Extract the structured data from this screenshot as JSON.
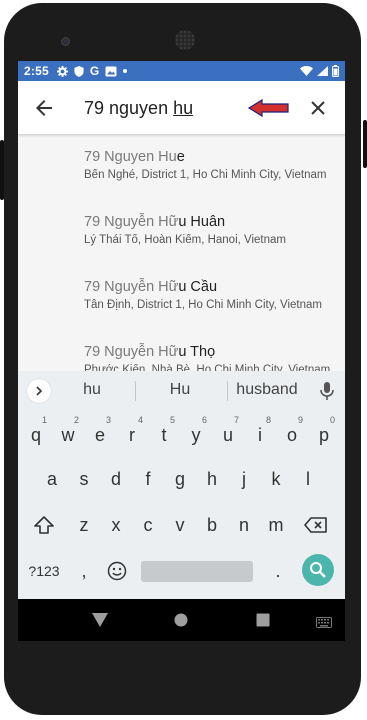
{
  "status_bar": {
    "time": "2:55",
    "icons_left": [
      "gear-icon",
      "shield-icon",
      "google-icon",
      "image-icon",
      "dot-icon"
    ],
    "icons_right": [
      "wifi-icon",
      "signal-icon",
      "battery-icon"
    ]
  },
  "search": {
    "query_prefix": "79 nguyen ",
    "query_composing": "hu"
  },
  "results": [
    {
      "title_dim": "79 Nguyen Hu",
      "title_match": "e",
      "subtitle": "Bến Nghé, District 1, Ho Chi Minh City, Vietnam"
    },
    {
      "title_dim": "79 Nguyễn Hữ",
      "title_match": "u Huân",
      "subtitle": "Lý Thái Tổ, Hoàn Kiếm, Hanoi, Vietnam"
    },
    {
      "title_dim": "79 Nguyễn Hữ",
      "title_match": "u Cầu",
      "subtitle": "Tân Định, District 1, Ho Chi Minh City, Vietnam"
    },
    {
      "title_dim": "79 Nguyễn Hữ",
      "title_match": "u Thọ",
      "subtitle": "Phước Kiển, Nhà Bè, Ho Chi Minh City, Vietnam"
    }
  ],
  "keyboard": {
    "suggestions": [
      "hu",
      "Hu",
      "husband"
    ],
    "row1": [
      {
        "k": "q",
        "h": "1"
      },
      {
        "k": "w",
        "h": "2"
      },
      {
        "k": "e",
        "h": "3"
      },
      {
        "k": "r",
        "h": "4"
      },
      {
        "k": "t",
        "h": "5"
      },
      {
        "k": "y",
        "h": "6"
      },
      {
        "k": "u",
        "h": "7"
      },
      {
        "k": "i",
        "h": "8"
      },
      {
        "k": "o",
        "h": "9"
      },
      {
        "k": "p",
        "h": "0"
      }
    ],
    "row2": [
      "a",
      "s",
      "d",
      "f",
      "g",
      "h",
      "j",
      "k",
      "l"
    ],
    "row3": [
      "z",
      "x",
      "c",
      "v",
      "b",
      "n",
      "m"
    ],
    "symbols_label": "?123",
    "comma": ",",
    "period": "."
  },
  "colors": {
    "status_bar": "#3b6fbf",
    "accent_search_key": "#4db6ac",
    "annotation_arrow": "#d32f2f"
  }
}
